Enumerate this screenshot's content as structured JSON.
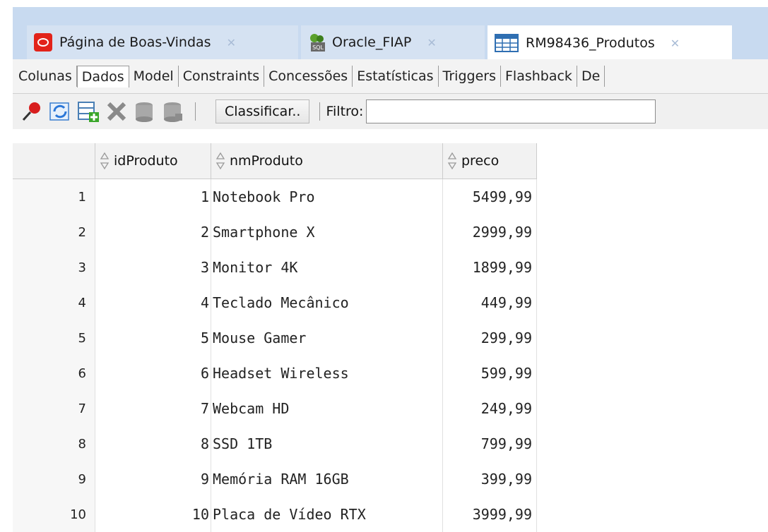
{
  "tabs": [
    {
      "label": "Página de Boas-Vindas",
      "icon": "oracle-logo-icon"
    },
    {
      "label": "Oracle_FIAP",
      "icon": "sql-connection-icon"
    },
    {
      "label": "RM98436_Produtos",
      "icon": "table-icon",
      "active": true
    }
  ],
  "subtabs": [
    "Colunas",
    "Dados",
    "Model",
    "Constraints",
    "Concessões",
    "Estatísticas",
    "Triggers",
    "Flashback",
    "De"
  ],
  "toolbar": {
    "sort_label": "Classificar..",
    "filter_label": "Filtro:",
    "filter_value": ""
  },
  "columns": [
    "idProduto",
    "nmProduto",
    "preco"
  ],
  "rows": [
    {
      "num": "1",
      "id": "1",
      "nm": "Notebook Pro",
      "preco": "5499,99"
    },
    {
      "num": "2",
      "id": "2",
      "nm": "Smartphone X",
      "preco": "2999,99"
    },
    {
      "num": "3",
      "id": "3",
      "nm": "Monitor 4K",
      "preco": "1899,99"
    },
    {
      "num": "4",
      "id": "4",
      "nm": "Teclado Mecânico",
      "preco": "449,99"
    },
    {
      "num": "5",
      "id": "5",
      "nm": "Mouse Gamer",
      "preco": "299,99"
    },
    {
      "num": "6",
      "id": "6",
      "nm": "Headset Wireless",
      "preco": "599,99"
    },
    {
      "num": "7",
      "id": "7",
      "nm": "Webcam HD",
      "preco": "249,99"
    },
    {
      "num": "8",
      "id": "8",
      "nm": "SSD 1TB",
      "preco": "799,99"
    },
    {
      "num": "9",
      "id": "9",
      "nm": "Memória RAM 16GB",
      "preco": "399,99"
    },
    {
      "num": "10",
      "id": "10",
      "nm": "Placa de Vídeo RTX",
      "preco": "3999,99"
    }
  ]
}
